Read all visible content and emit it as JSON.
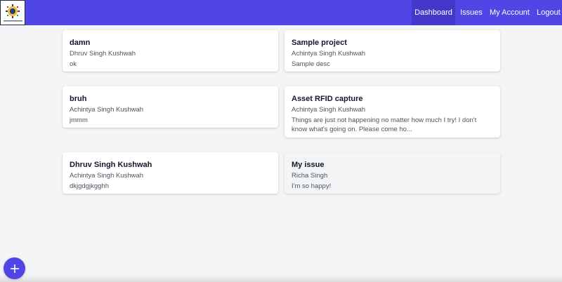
{
  "colors": {
    "brand": "#4f46e5",
    "active_nav": "#4338ca",
    "page_bg": "#f3f4f6"
  },
  "logo": {
    "icon": "gear-logo-icon",
    "caption": "CENTRAL LEARNING CENTRE"
  },
  "nav": {
    "dashboard": "Dashboard",
    "issues": "Issues",
    "my_account": "My Account",
    "logout": "Logout",
    "active": "Dashboard"
  },
  "cards": [
    {
      "title": "damn",
      "author": "Dhruv Singh Kushwah",
      "description": "ok"
    },
    {
      "title": "Sample project",
      "author": "Achintya Singh Kushwah",
      "description": "Sample desc"
    },
    {
      "title": "bruh",
      "author": "Achintya Singh Kushwah",
      "description": "jmmm"
    },
    {
      "title": "Asset RFID capture",
      "author": "Achintya Singh Kushwah",
      "description": "Things are just not happening no matter how much I try! I don't know what's going on. Please come ho..."
    },
    {
      "title": "Dhruv Singh Kushwah",
      "author": "Achintya Singh Kushwah",
      "description": "dkjgdgjkgghh"
    },
    {
      "title": "My issue",
      "author": "Richa Singh",
      "description": "I'm so happy!"
    }
  ],
  "fab": {
    "icon": "plus-icon"
  }
}
